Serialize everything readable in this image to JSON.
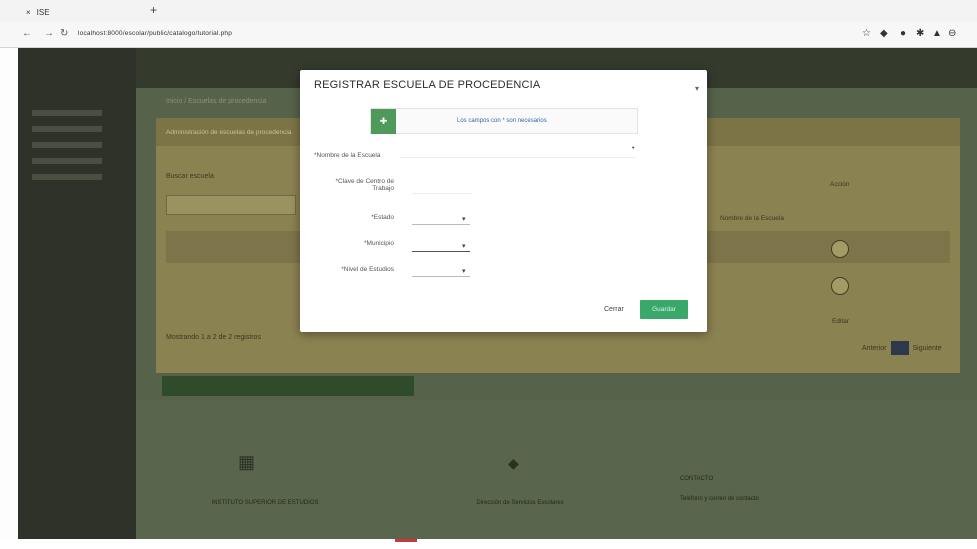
{
  "browser": {
    "tab_title": "ISE",
    "url": "localhost:8000/escolar/public/catalogo/tutorial.php"
  },
  "background_page": {
    "breadcrumb": "Inicio / Escuelas de procedencia",
    "panel_title": "Administración de escuelas de procedencia",
    "search_label": "Buscar escuela",
    "column_header": "Nombre de la Escuela",
    "action_header": "Acción",
    "row_action": "Editar",
    "showing_text": "Mostrando 1 a 2 de 2 registros",
    "pager_prev": "Anterior",
    "pager_next": "Siguiente",
    "footer_left": "INSTITUTO SUPERIOR DE ESTUDIOS",
    "footer_center": "Dirección de Servicios Escolares",
    "footer_right_title": "CONTACTO",
    "footer_right_line": "Teléfono y correo de contacto"
  },
  "modal": {
    "title": "REGISTRAR ESCUELA DE PROCEDENCIA",
    "alert_text": "Los campos con * son necesarios",
    "fields": [
      {
        "label": "*Nombre de la Escuela"
      },
      {
        "label": "*Clave de Centro de Trabajo"
      },
      {
        "label": "*Estado"
      },
      {
        "label": "*Municipio"
      },
      {
        "label": "*Nivel de Estudios"
      }
    ],
    "cancel_label": "Cerrar",
    "save_label": "Guardar"
  },
  "colors": {
    "save_button": "#3aa86a",
    "alert_icon": "#4f9a5a",
    "alert_text": "#2c6aa8"
  }
}
